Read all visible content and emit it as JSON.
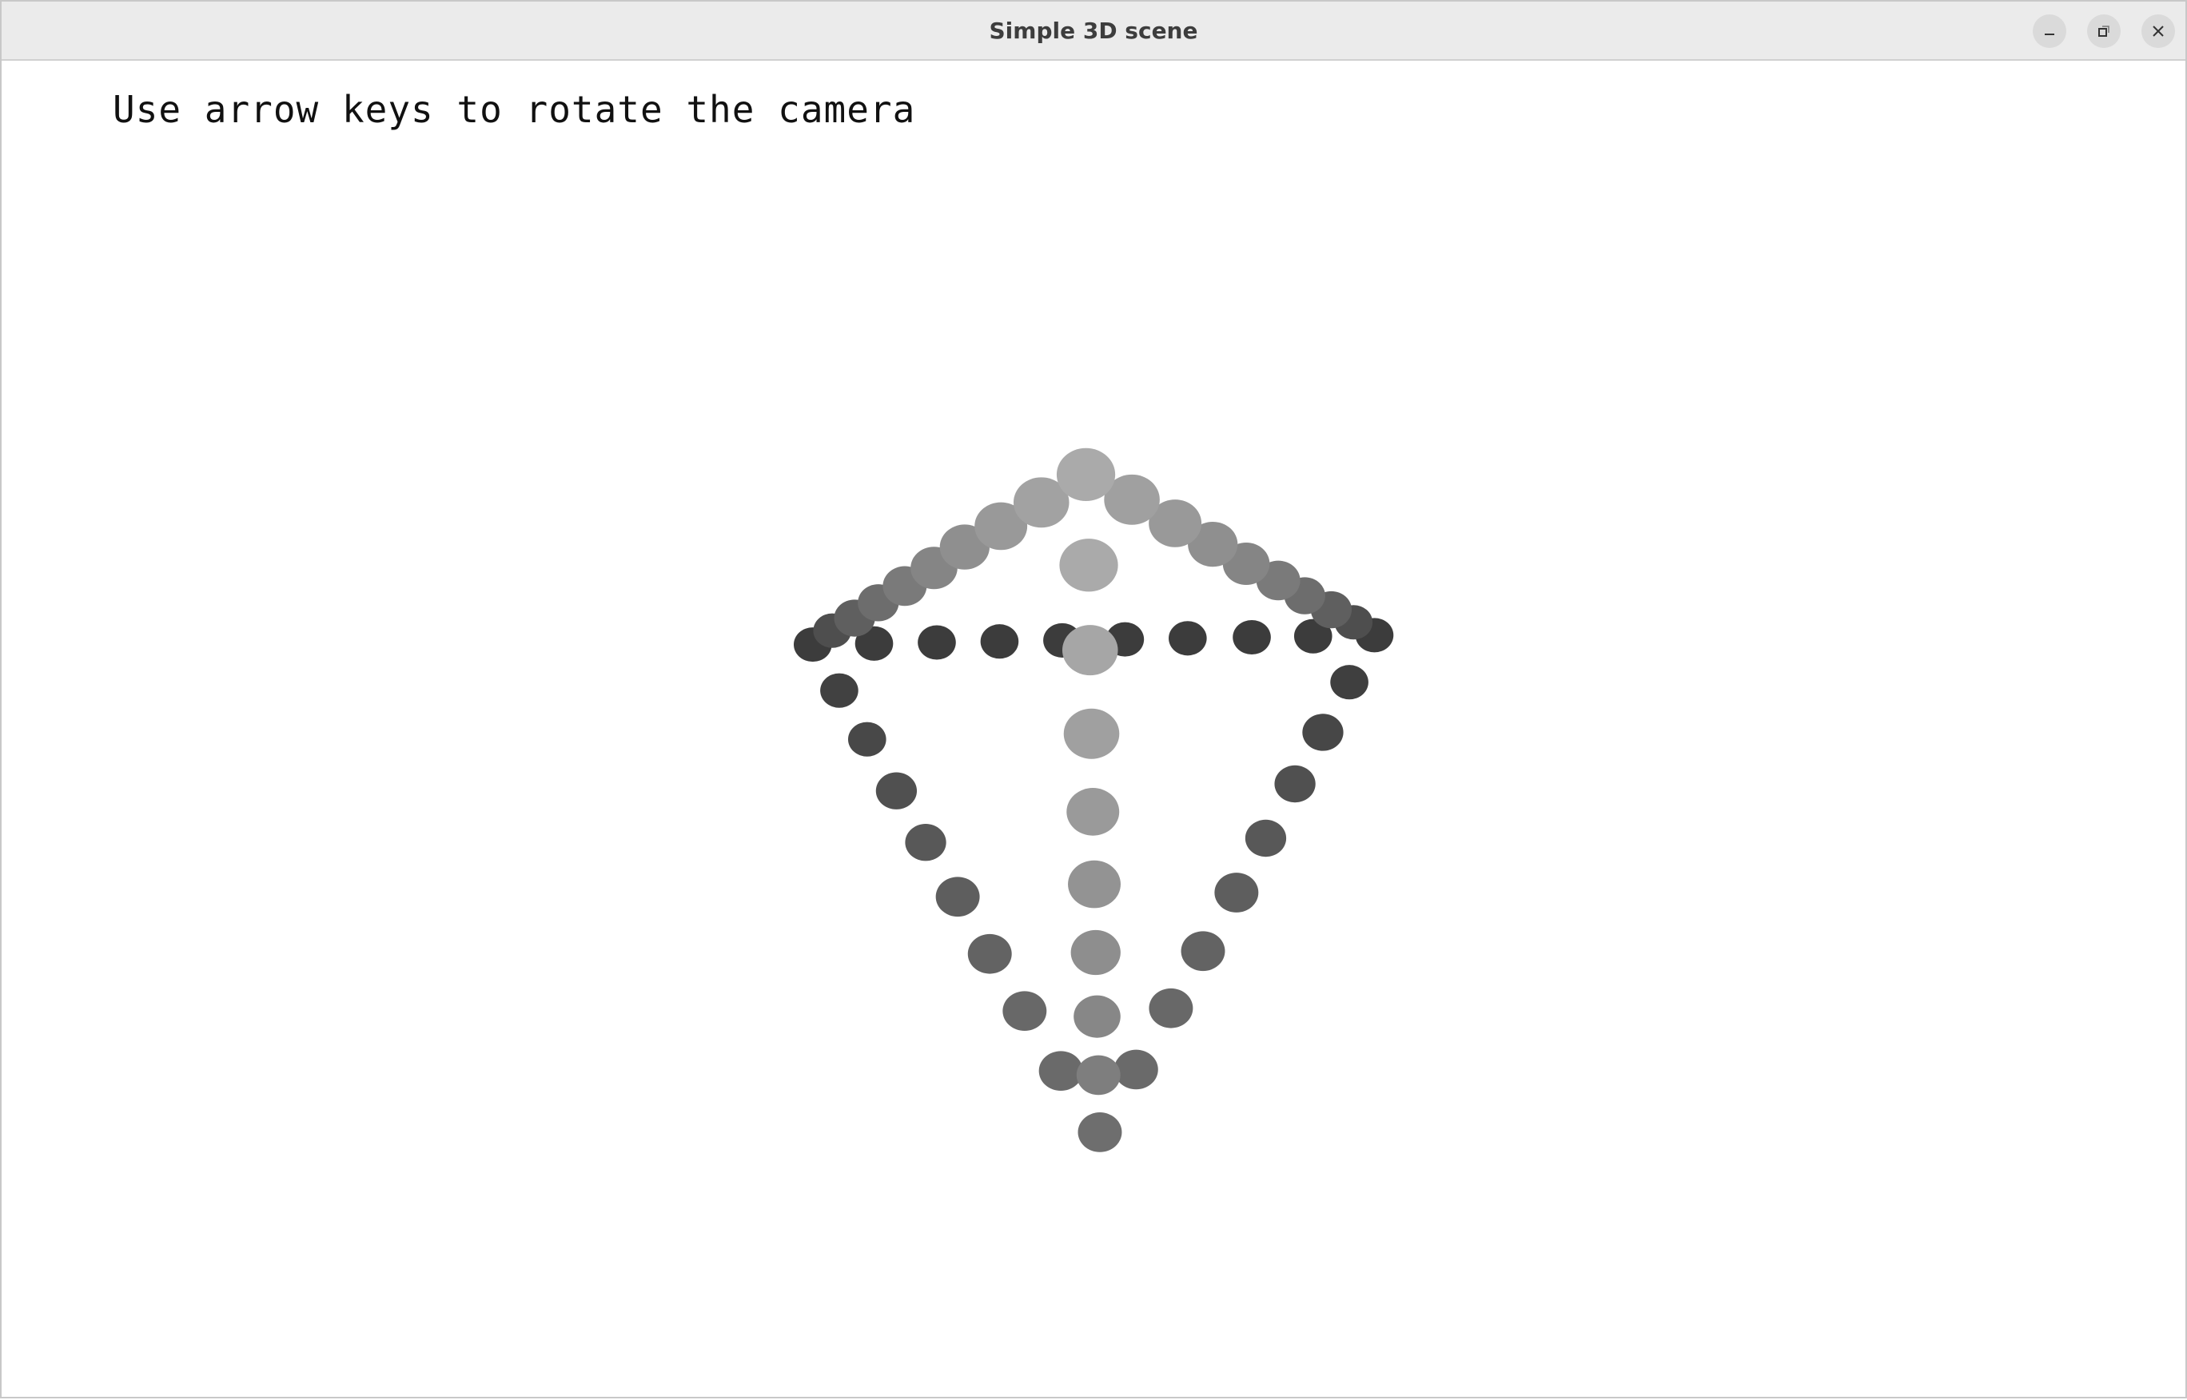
{
  "window": {
    "title": "Simple 3D scene",
    "controls": [
      "minimize",
      "restore",
      "close"
    ]
  },
  "scene": {
    "hint_text": "Use arrow keys to rotate the camera",
    "background_color": "#ffffff"
  }
}
